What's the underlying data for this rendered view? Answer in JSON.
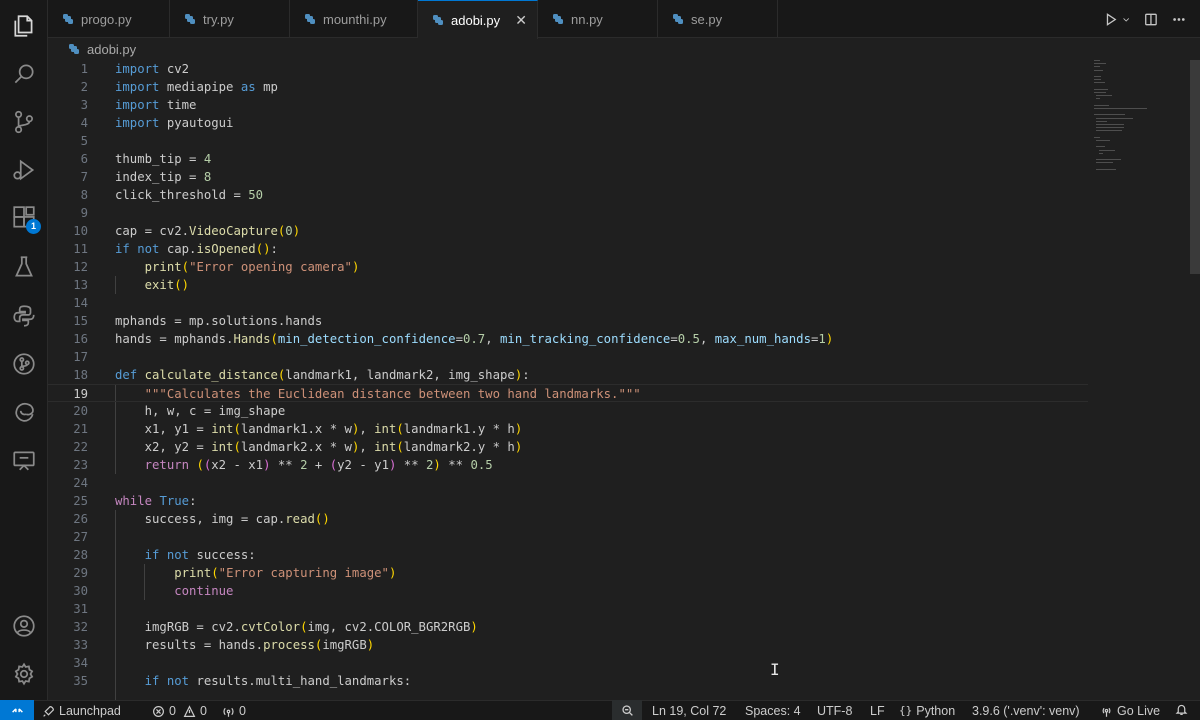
{
  "tabs": [
    {
      "label": "progo.py"
    },
    {
      "label": "try.py"
    },
    {
      "label": "mounthi.py"
    },
    {
      "label": "adobi.py"
    },
    {
      "label": "nn.py"
    },
    {
      "label": "se.py"
    }
  ],
  "tab_close_glyph": "✕",
  "breadcrumb": {
    "file": "adobi.py"
  },
  "activity_bar": {
    "extensions_badge": "1"
  },
  "editor": {
    "current_line": 19,
    "line_numbers": [
      "1",
      "2",
      "3",
      "4",
      "5",
      "6",
      "7",
      "8",
      "9",
      "10",
      "11",
      "12",
      "13",
      "14",
      "15",
      "16",
      "17",
      "18",
      "19",
      "20",
      "21",
      "22",
      "23",
      "24",
      "25",
      "26",
      "27",
      "28",
      "29",
      "30",
      "31",
      "32",
      "33",
      "34",
      "35"
    ],
    "lines": [
      "import cv2",
      "import mediapipe as mp",
      "import time",
      "import pyautogui",
      "",
      "thumb_tip = 4",
      "index_tip = 8",
      "click_threshold = 50",
      "",
      "cap = cv2.VideoCapture(0)",
      "if not cap.isOpened():",
      "    print(\"Error opening camera\")",
      "    exit()",
      "",
      "mphands = mp.solutions.hands",
      "hands = mphands.Hands(min_detection_confidence=0.7, min_tracking_confidence=0.5, max_num_hands=1)",
      "",
      "def calculate_distance(landmark1, landmark2, img_shape):",
      "    \"\"\"Calculates the Euclidean distance between two hand landmarks.\"\"\"",
      "    h, w, c = img_shape",
      "    x1, y1 = int(landmark1.x * w), int(landmark1.y * h)",
      "    x2, y2 = int(landmark2.x * w), int(landmark2.y * h)",
      "    return ((x2 - x1) ** 2 + (y2 - y1) ** 2) ** 0.5",
      "",
      "while True:",
      "    success, img = cap.read()",
      "",
      "    if not success:",
      "        print(\"Error capturing image\")",
      "        continue",
      "",
      "    imgRGB = cv2.cvtColor(img, cv2.COLOR_BGR2RGB)",
      "    results = hands.process(imgRGB)",
      "",
      "    if not results.multi_hand_landmarks:"
    ]
  },
  "status_bar": {
    "launchpad": "Launchpad",
    "errors": "0",
    "warnings": "0",
    "ports": "0",
    "position": "Ln 19, Col 72",
    "spaces": "Spaces: 4",
    "encoding": "UTF-8",
    "eol": "LF",
    "language": "Python",
    "interpreter": "3.9.6 ('.venv': venv)",
    "go_live": "Go Live"
  },
  "colors": {
    "accent": "#0078d4",
    "background": "#1f1f1f",
    "keyword": "#569cd6",
    "control_keyword": "#c586c0",
    "function": "#dcdcaa",
    "string": "#ce9178",
    "number": "#b5cea8"
  }
}
